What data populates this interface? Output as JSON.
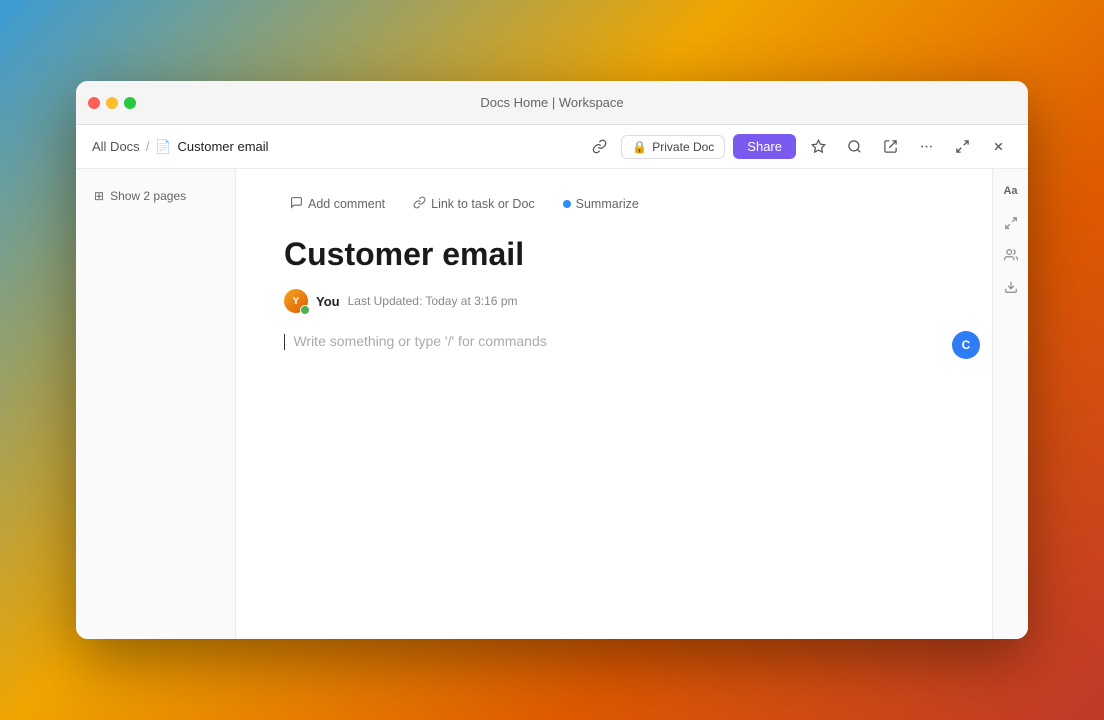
{
  "window": {
    "title": "Docs Home | Workspace"
  },
  "titlebar": {
    "title": "Docs Home | Workspace",
    "traffic_lights": {
      "close": "close",
      "minimize": "minimize",
      "maximize": "maximize"
    }
  },
  "breadcrumb": {
    "all_docs": "All Docs",
    "separator": "/",
    "doc_icon": "🗎",
    "current": "Customer email"
  },
  "header_actions": {
    "share_label": "Share",
    "private_doc_label": "Private Doc",
    "lock_icon": "🔒",
    "star_icon": "☆",
    "search_icon": "🔍",
    "export_icon": "↗",
    "more_icon": "···",
    "restore_icon": "⤢",
    "close_icon": "✕"
  },
  "sidebar": {
    "show_pages_label": "Show 2 pages",
    "pages_icon": "⊞"
  },
  "toolbar": {
    "add_comment_label": "Add comment",
    "add_comment_icon": "💬",
    "link_task_label": "Link to task or Doc",
    "link_task_icon": "🔗",
    "summarize_label": "Summarize",
    "summarize_dot_color": "#2d8cff"
  },
  "document": {
    "title": "Customer email",
    "author": "You",
    "last_updated": "Last Updated: Today at 3:16 pm",
    "placeholder": "Write something or type '/' for commands"
  },
  "right_sidebar": {
    "font_icon": "Aa",
    "expand_icon": "⇔",
    "person_icon": "👤",
    "download_icon": "⬇"
  }
}
